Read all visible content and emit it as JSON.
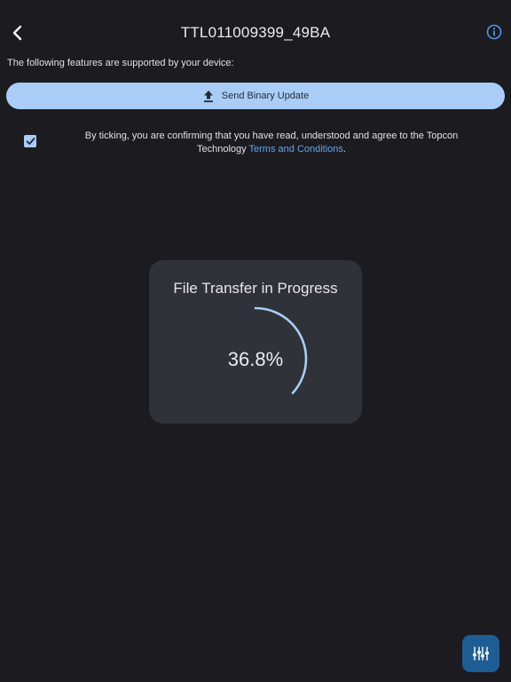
{
  "header": {
    "title": "TTL011009399_49BA",
    "back_icon": "chevron-left-icon",
    "info_icon": "info-circle-icon"
  },
  "features_label": "The following features are supported by your device:",
  "send_button": {
    "label": "Send Binary Update",
    "icon": "upload-icon"
  },
  "agreement": {
    "checked": true,
    "text": "By ticking, you are confirming that you have read, understood and agree to the Topcon Technology",
    "link_text": "Terms and Conditions",
    "suffix": "."
  },
  "progress": {
    "title": "File Transfer in Progress",
    "value_text": "36.8%",
    "fraction": 0.368
  },
  "fab": {
    "icon": "equalizer-sliders-icon"
  },
  "colors": {
    "background": "#1c1b20",
    "accent": "#a9cdf7",
    "link": "#5ea6ee",
    "card": "#2f3238",
    "fab": "#1d5d93"
  }
}
